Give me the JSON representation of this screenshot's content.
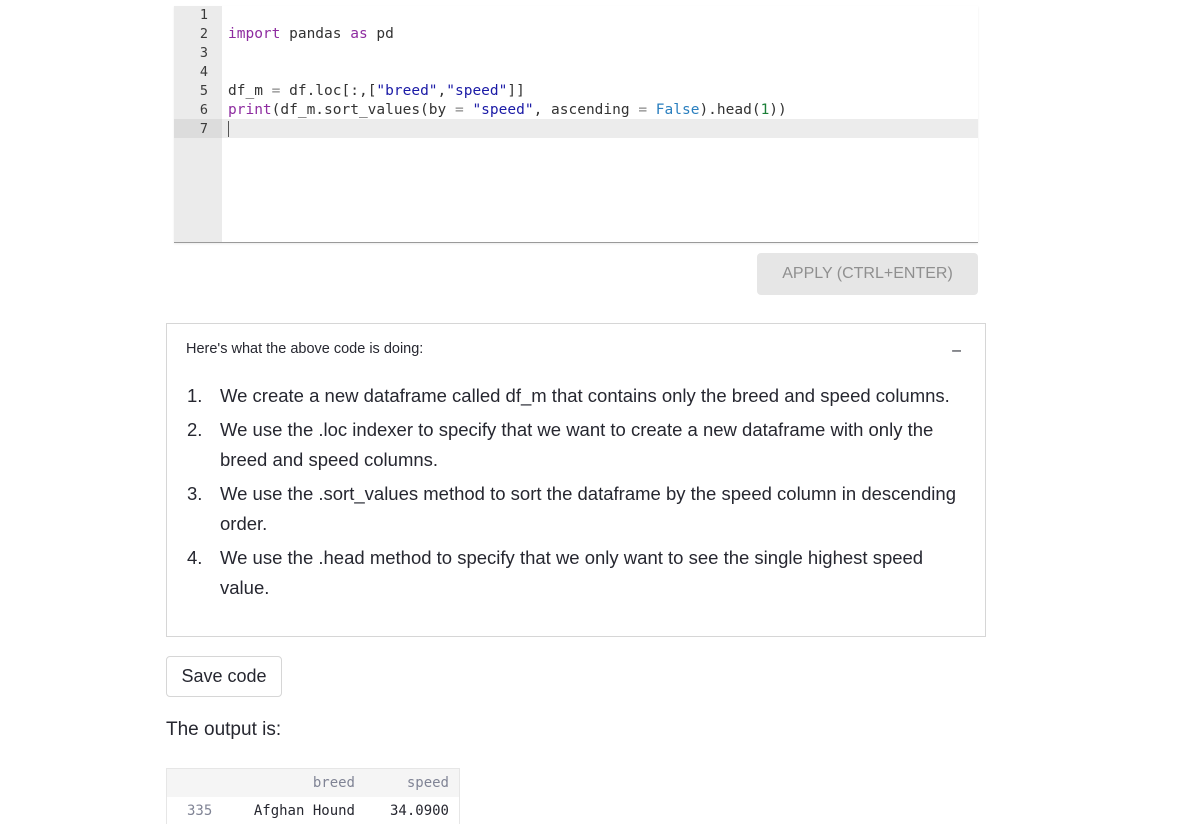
{
  "editor": {
    "line_numbers": [
      "1",
      "2",
      "3",
      "4",
      "5",
      "6",
      "7"
    ],
    "lines": [
      {
        "segments": []
      },
      {
        "segments": [
          {
            "text": "import",
            "cls": "kw"
          },
          {
            "text": " pandas ",
            "cls": ""
          },
          {
            "text": "as",
            "cls": "kw"
          },
          {
            "text": " pd",
            "cls": ""
          }
        ]
      },
      {
        "segments": []
      },
      {
        "segments": []
      },
      {
        "segments": [
          {
            "text": "df_m ",
            "cls": ""
          },
          {
            "text": "=",
            "cls": "op"
          },
          {
            "text": " df.loc[:,[",
            "cls": ""
          },
          {
            "text": "\"breed\"",
            "cls": "str"
          },
          {
            "text": ",",
            "cls": ""
          },
          {
            "text": "\"speed\"",
            "cls": "str"
          },
          {
            "text": "]]",
            "cls": ""
          }
        ]
      },
      {
        "segments": [
          {
            "text": "print",
            "cls": "kw"
          },
          {
            "text": "(df_m.sort_values(by ",
            "cls": ""
          },
          {
            "text": "=",
            "cls": "op"
          },
          {
            "text": " ",
            "cls": ""
          },
          {
            "text": "\"speed\"",
            "cls": "str"
          },
          {
            "text": ", ascending ",
            "cls": ""
          },
          {
            "text": "=",
            "cls": "op"
          },
          {
            "text": " ",
            "cls": ""
          },
          {
            "text": "False",
            "cls": "bool"
          },
          {
            "text": ").head(",
            "cls": ""
          },
          {
            "text": "1",
            "cls": "num"
          },
          {
            "text": "))",
            "cls": ""
          }
        ]
      },
      {
        "segments": []
      }
    ]
  },
  "apply_button": "APPLY (CTRL+ENTER)",
  "explanation": {
    "heading": "Here's what the above code is doing:",
    "collapse_symbol": "–",
    "steps": [
      {
        "number": "1.",
        "text": "We create a new dataframe called df_m that contains only the breed and speed columns."
      },
      {
        "number": "2.",
        "text": "We use the .loc indexer to specify that we want to create a new dataframe with only the breed and speed columns."
      },
      {
        "number": "3.",
        "text": "We use the .sort_values method to sort the dataframe by the speed column in descending order."
      },
      {
        "number": "4.",
        "text": "We use the .head method to specify that we only want to see the single highest speed value."
      }
    ]
  },
  "save_button": "Save code",
  "output_label": "The output is:",
  "output_table": {
    "columns": [
      "breed",
      "speed"
    ],
    "rows": [
      {
        "index": "335",
        "breed": "Afghan Hound",
        "speed": "34.0900"
      }
    ]
  }
}
